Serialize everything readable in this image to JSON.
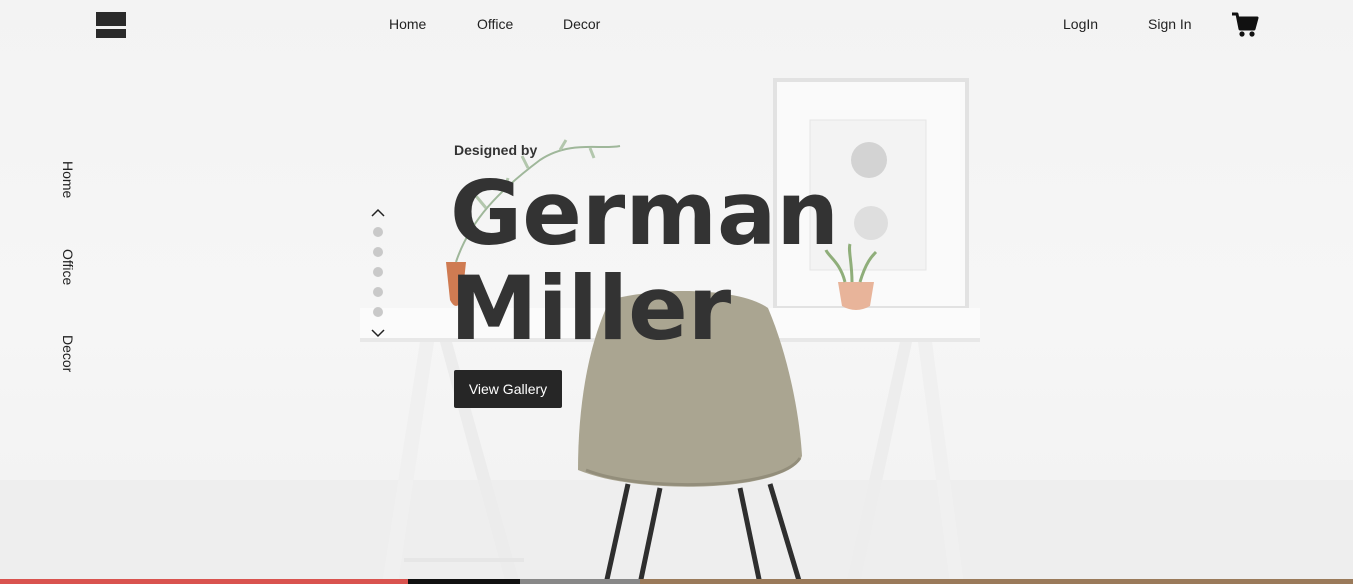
{
  "header": {
    "nav": [
      {
        "label": "Home"
      },
      {
        "label": "Office"
      },
      {
        "label": "Decor"
      }
    ],
    "login_label": "LogIn",
    "signin_label": "Sign In"
  },
  "sidebar": {
    "items": [
      {
        "label": "Home"
      },
      {
        "label": "Office"
      },
      {
        "label": "Decor"
      }
    ]
  },
  "hero": {
    "eyebrow": "Designed by",
    "title_line1": "German",
    "title_line2": "Miller",
    "cta_label": "View Gallery"
  },
  "slider": {
    "dot_count": 5
  },
  "colors": {
    "primary_dark": "#262626",
    "text": "#333333",
    "dot": "#c9c9c9",
    "strip": [
      "#d9534f",
      "#111111",
      "#888888",
      "#9a7a5a"
    ]
  },
  "icons": [
    "logo-mark",
    "cart-icon",
    "chevron-up-icon",
    "chevron-down-icon"
  ]
}
